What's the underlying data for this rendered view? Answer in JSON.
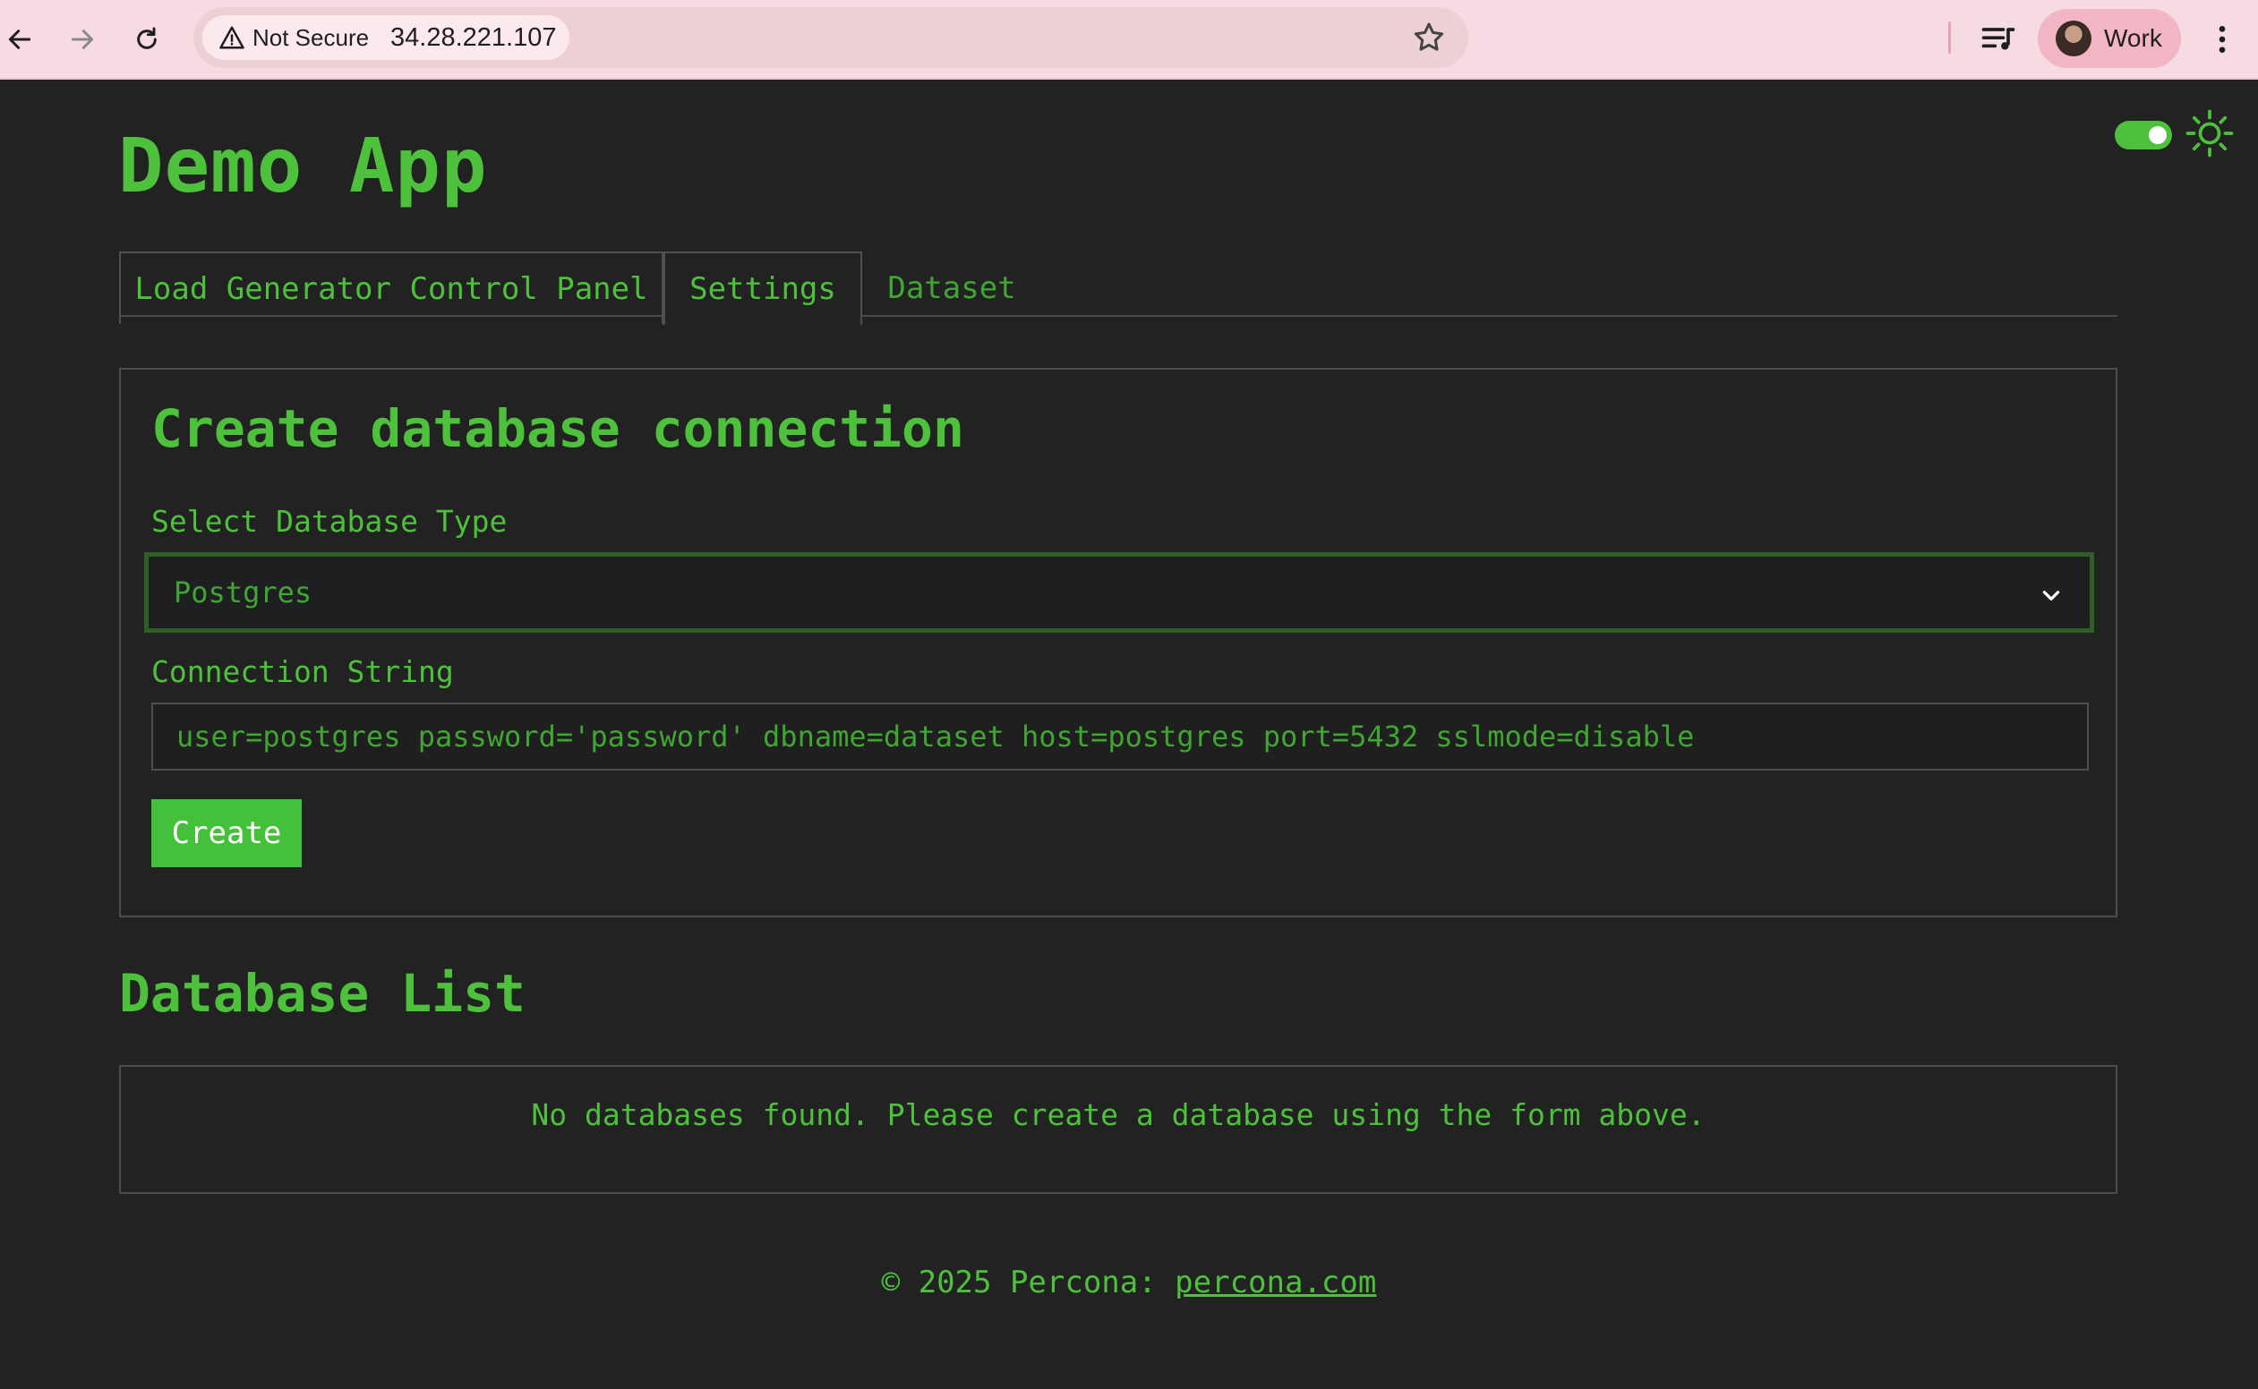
{
  "browser": {
    "security_label": "Not Secure",
    "url": "34.28.221.107",
    "profile_name": "Work"
  },
  "app": {
    "title": "Demo App"
  },
  "tabs": [
    {
      "label": "Load Generator Control Panel"
    },
    {
      "label": "Settings"
    },
    {
      "label": "Dataset"
    }
  ],
  "active_tab": "Settings",
  "connection_form": {
    "title": "Create database connection",
    "db_type_label": "Select Database Type",
    "db_type_value": "Postgres",
    "conn_string_label": "Connection String",
    "conn_string_value": "user=postgres password='password' dbname=dataset host=postgres port=5432 sslmode=disable",
    "create_label": "Create"
  },
  "database_list": {
    "title": "Database List",
    "empty_message": "No databases found. Please create a database using the form above."
  },
  "footer": {
    "prefix": "© 2025 Percona: ",
    "link_text": "percona.com"
  },
  "colors": {
    "accent": "#4ec13c",
    "background": "#222222",
    "button": "#45c03a"
  }
}
